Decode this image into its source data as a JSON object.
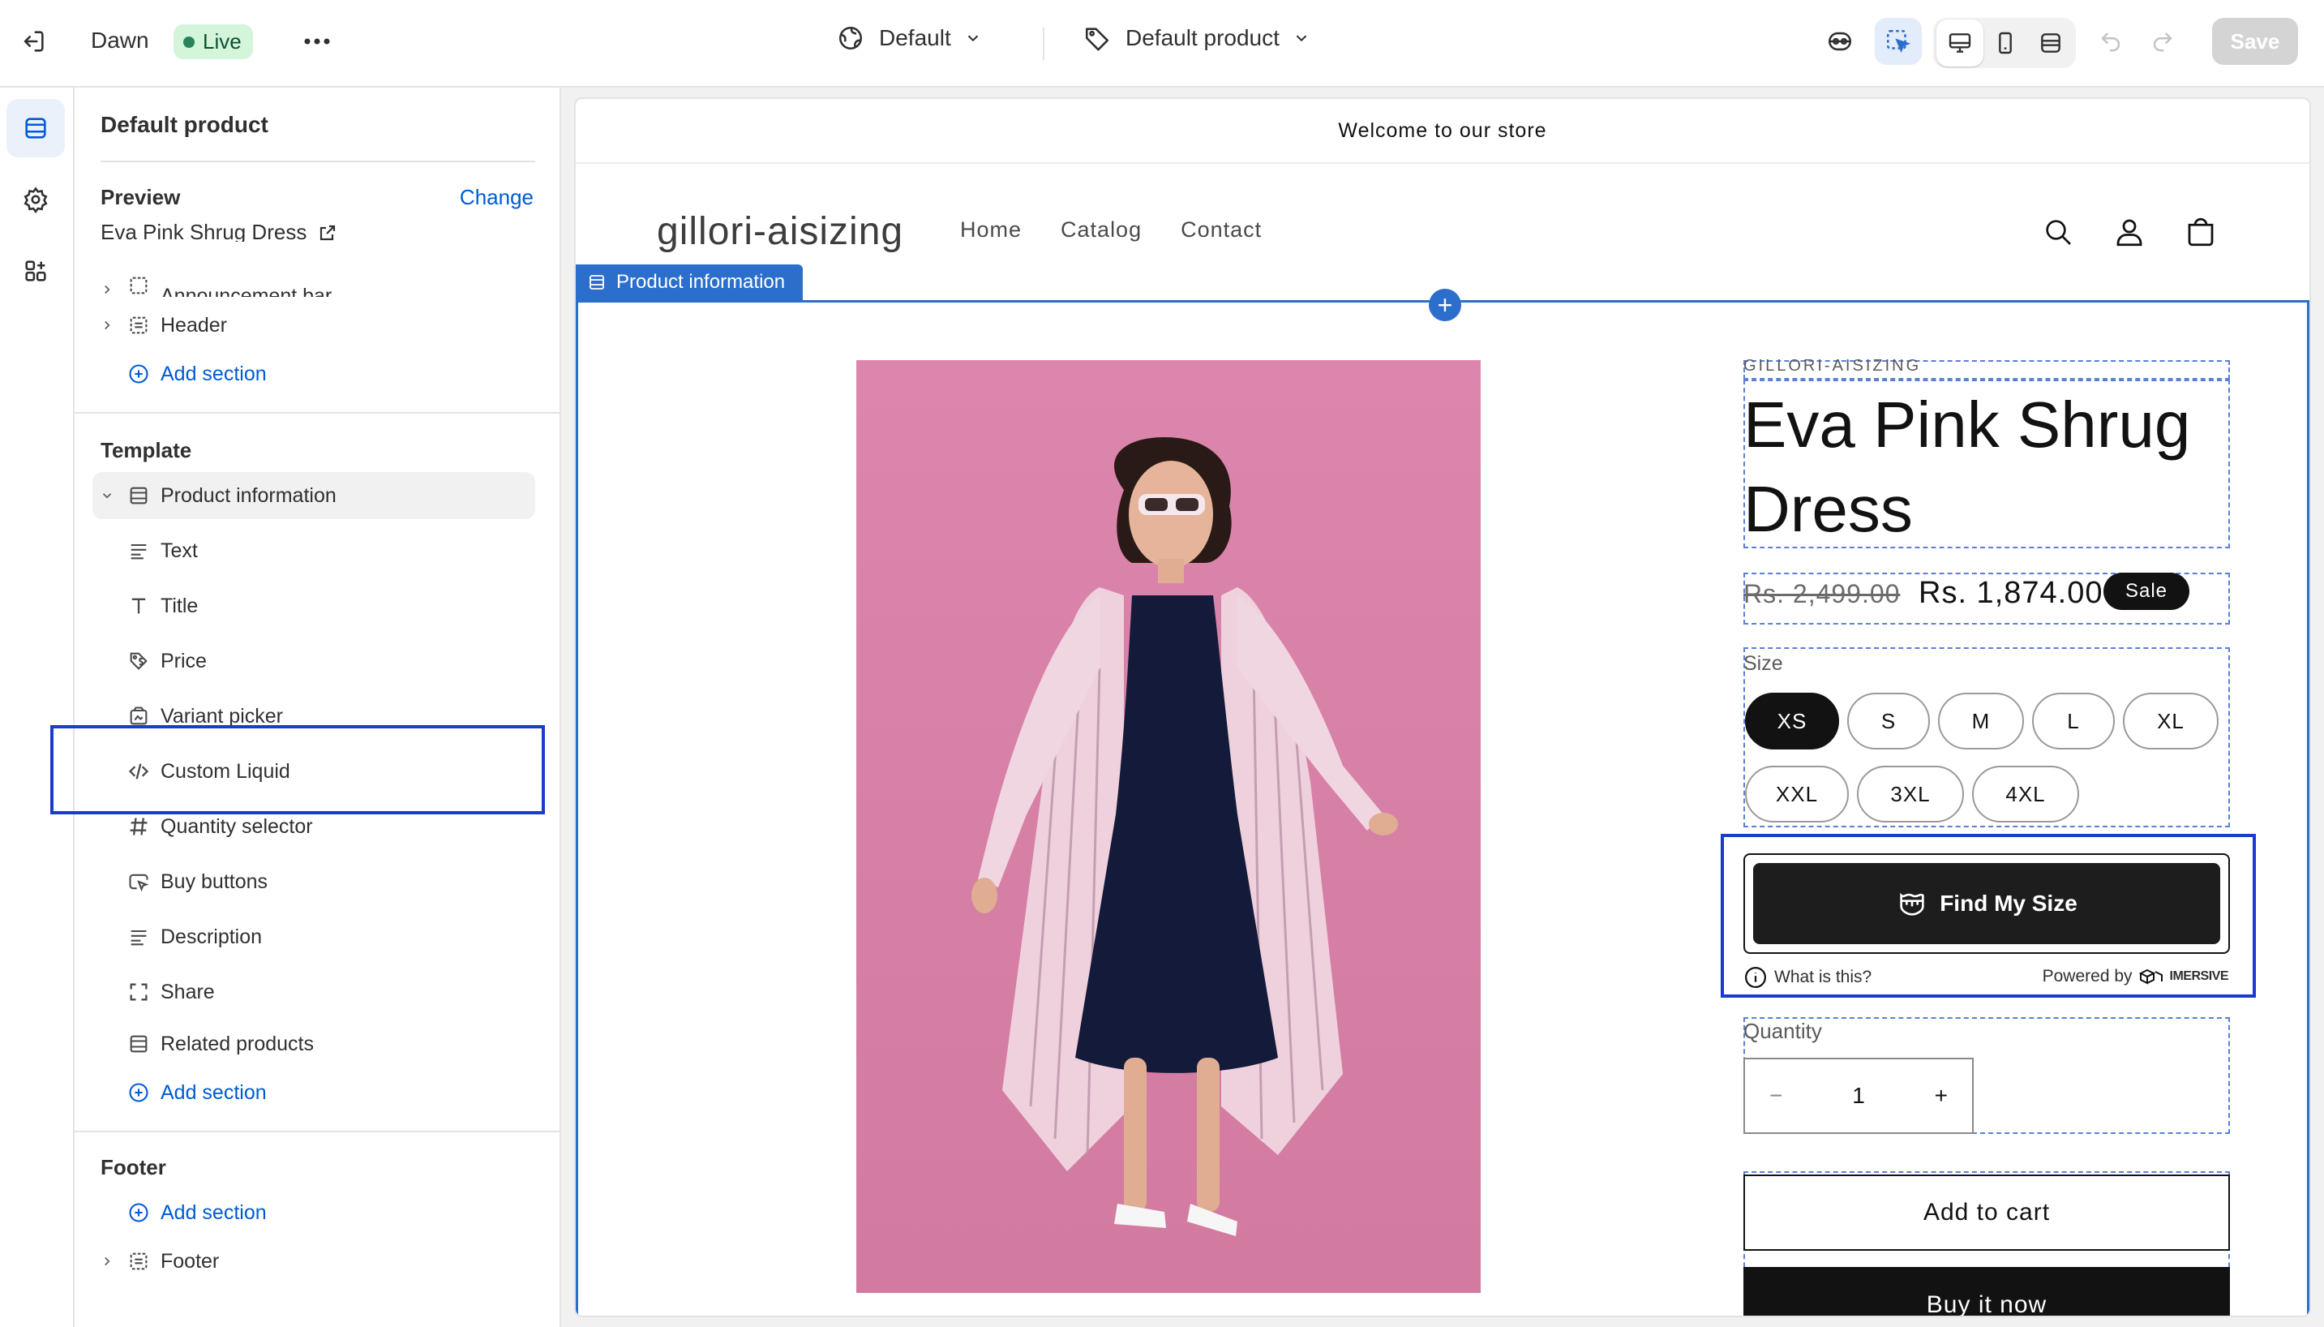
{
  "topbar": {
    "theme_name": "Dawn",
    "live_label": "Live",
    "template_selector": "Default",
    "product_selector": "Default product",
    "save_label": "Save"
  },
  "sidebar": {
    "title": "Default product",
    "preview_label": "Preview",
    "change_label": "Change",
    "preview_value": "Eva Pink Shrug Dress",
    "header_group": {
      "announcement_bar": "Announcement bar",
      "header": "Header",
      "add_section": "Add section"
    },
    "template_group": {
      "title": "Template",
      "section": "Product information",
      "blocks": [
        "Text",
        "Title",
        "Price",
        "Variant picker",
        "Custom Liquid",
        "Quantity selector",
        "Buy buttons",
        "Description",
        "Share"
      ],
      "related": "Related products",
      "add_section": "Add section"
    },
    "footer_group": {
      "title": "Footer",
      "add_section": "Add section",
      "footer": "Footer"
    }
  },
  "store": {
    "announcement": "Welcome to our store",
    "logo": "gillori-aisizing",
    "nav": [
      "Home",
      "Catalog",
      "Contact"
    ],
    "section_tag": "Product information",
    "vendor": "GILLORI-AISIZING",
    "product_title": "Eva Pink Shrug Dress",
    "price_regular": "Rs. 2,499.00",
    "price_sale": "Rs. 1,874.00",
    "sale_badge": "Sale",
    "size_label": "Size",
    "sizes": [
      "XS",
      "S",
      "M",
      "L",
      "XL",
      "XXL",
      "3XL",
      "4XL"
    ],
    "selected_size": "XS",
    "find_my_size": "Find My Size",
    "what_is_this": "What is this?",
    "powered_by": "Powered by",
    "powered_brand": "IMERSIVE",
    "quantity_label": "Quantity",
    "quantity_value": "1",
    "qty_minus": "−",
    "qty_plus": "+",
    "add_to_cart": "Add to cart",
    "buy_it_now": "Buy it now"
  },
  "colors": {
    "accent": "#005bd3",
    "section_blue": "#2c6ecb",
    "highlight": "#1a3bcc",
    "live_bg": "#d4f5d9",
    "photo_bg": "#d87fa5"
  }
}
